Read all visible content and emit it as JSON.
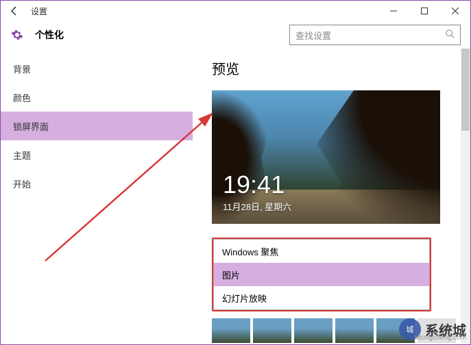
{
  "titlebar": {
    "title": "设置"
  },
  "header": {
    "heading": "个性化",
    "search_placeholder": "查找设置"
  },
  "sidebar": {
    "items": [
      {
        "label": "背景"
      },
      {
        "label": "颜色"
      },
      {
        "label": "锁屏界面"
      },
      {
        "label": "主题"
      },
      {
        "label": "开始"
      }
    ]
  },
  "main": {
    "preview_title": "预览",
    "clock": "19:41",
    "date": "11月28日, 星期六",
    "dropdown": {
      "options": [
        {
          "label": "Windows 聚焦"
        },
        {
          "label": "图片"
        },
        {
          "label": "幻灯片放映"
        }
      ]
    }
  },
  "watermark": {
    "text": "系统城",
    "sub": "xitongcheng.com"
  }
}
